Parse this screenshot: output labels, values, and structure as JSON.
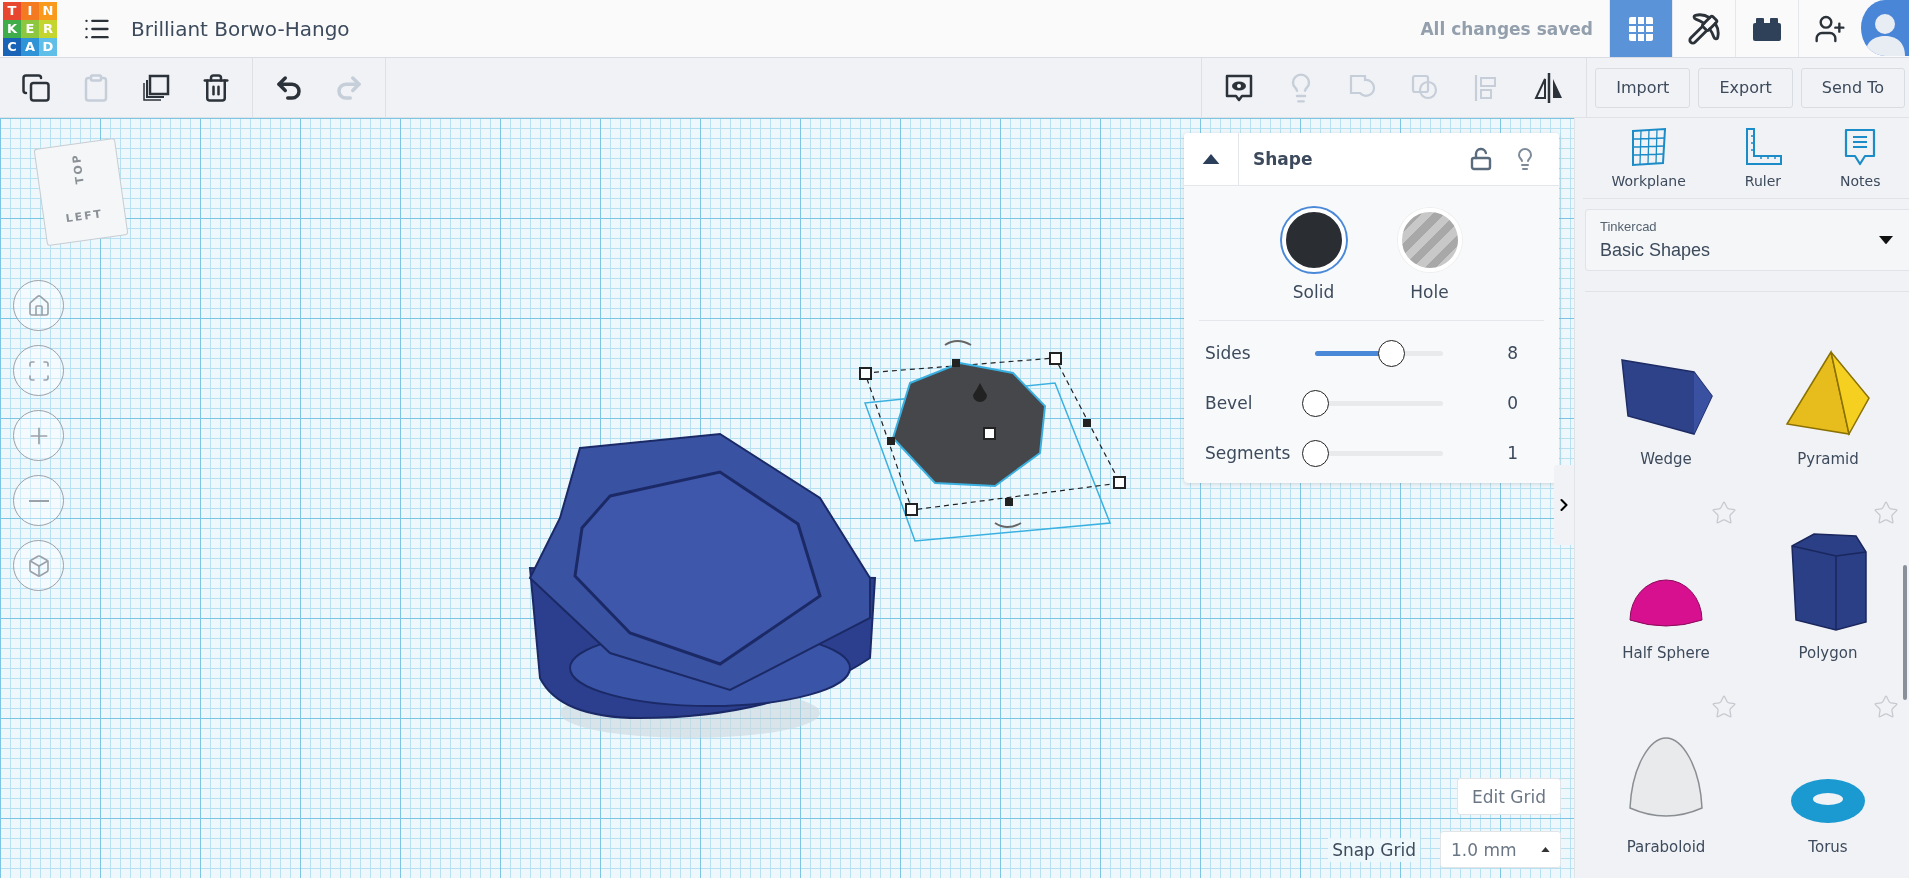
{
  "logo": [
    {
      "letter": "T",
      "color": "#e8472f"
    },
    {
      "letter": "I",
      "color": "#f47a22"
    },
    {
      "letter": "N",
      "color": "#f99a1c"
    },
    {
      "letter": "K",
      "color": "#3fae4a"
    },
    {
      "letter": "E",
      "color": "#8dc63f"
    },
    {
      "letter": "R",
      "color": "#c5d52f"
    },
    {
      "letter": "C",
      "color": "#1a64b8"
    },
    {
      "letter": "A",
      "color": "#2f93d8"
    },
    {
      "letter": "D",
      "color": "#5fbfe8"
    }
  ],
  "project_title": "Brilliant Borwo-Hango",
  "save_status": "All changes saved",
  "nav_buttons": [
    {
      "selected": true
    },
    {
      "selected": false
    },
    {
      "selected": false
    },
    {
      "selected": false
    }
  ],
  "edit_tools": [
    {
      "disabled": false
    },
    {
      "disabled": true
    },
    {
      "disabled": false
    },
    {
      "disabled": false
    }
  ],
  "history_tools": [
    {
      "disabled": false
    },
    {
      "disabled": true
    }
  ],
  "view_tools": [
    {
      "disabled": false
    },
    {
      "disabled": true
    },
    {
      "disabled": true
    },
    {
      "disabled": true
    },
    {
      "disabled": true
    },
    {
      "disabled": false
    }
  ],
  "actions": [
    "Import",
    "Export",
    "Send To"
  ],
  "view_cube": {
    "top": "TOP",
    "left": "LEFT"
  },
  "shape_panel": {
    "title": "Shape",
    "modes": [
      {
        "label": "Solid",
        "kind": "solid",
        "selected": true
      },
      {
        "label": "Hole",
        "kind": "hole",
        "selected": false
      }
    ],
    "params": [
      {
        "label": "Sides",
        "level": 0.59,
        "value": "8"
      },
      {
        "label": "Bevel",
        "level": 0,
        "value": "0"
      },
      {
        "label": "Segments",
        "level": 0,
        "value": "1"
      }
    ]
  },
  "grid_controls": {
    "edit_button": "Edit Grid",
    "snap_label": "Snap Grid",
    "snap_value": "1.0 mm"
  },
  "sidebar": {
    "tools": [
      {
        "label": "Workplane"
      },
      {
        "label": "Ruler"
      },
      {
        "label": "Notes"
      }
    ],
    "library": {
      "provider": "Tinkercad",
      "name": "Basic Shapes"
    },
    "shapes": [
      {
        "label": "Wedge",
        "kind": "wedge"
      },
      {
        "label": "Pyramid",
        "kind": "pyramid"
      },
      {
        "label": "Half Sphere",
        "kind": "half_sphere",
        "favorite": false
      },
      {
        "label": "Polygon",
        "kind": "polygon",
        "favorite": false
      },
      {
        "label": "Paraboloid",
        "kind": "paraboloid",
        "favorite": false
      },
      {
        "label": "Torus",
        "kind": "torus",
        "favorite": false
      }
    ]
  }
}
